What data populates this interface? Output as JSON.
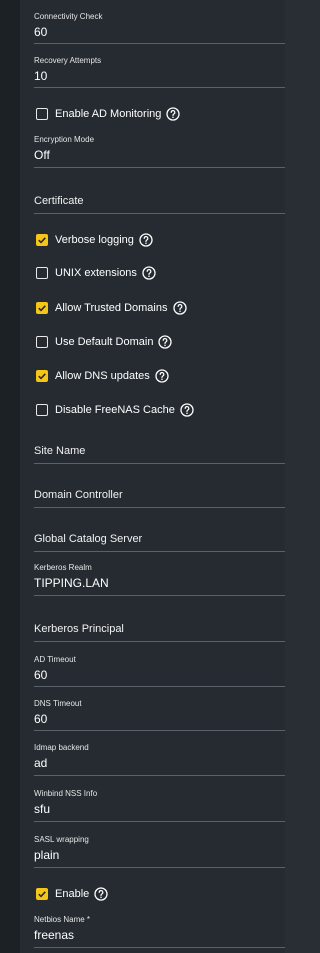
{
  "fields": {
    "connectivity_check": {
      "label": "Connectivity Check",
      "value": "60"
    },
    "recovery_attempts": {
      "label": "Recovery Attempts",
      "value": "10"
    },
    "encryption_mode": {
      "label": "Encryption Mode",
      "value": "Off"
    },
    "certificate": {
      "placeholder": "Certificate"
    },
    "site_name": {
      "placeholder": "Site Name"
    },
    "domain_controller": {
      "placeholder": "Domain Controller"
    },
    "global_catalog_server": {
      "placeholder": "Global Catalog Server"
    },
    "kerberos_realm": {
      "label": "Kerberos Realm",
      "value": "TIPPING.LAN"
    },
    "kerberos_principal": {
      "placeholder": "Kerberos Principal"
    },
    "ad_timeout": {
      "label": "AD Timeout",
      "value": "60"
    },
    "dns_timeout": {
      "label": "DNS Timeout",
      "value": "60"
    },
    "idmap_backend": {
      "label": "Idmap backend",
      "value": "ad"
    },
    "winbind_nss_info": {
      "label": "Winbind NSS Info",
      "value": "sfu"
    },
    "sasl_wrapping": {
      "label": "SASL wrapping",
      "value": "plain"
    },
    "netbios_name": {
      "label": "Netbios Name *",
      "value": "freenas"
    }
  },
  "checkboxes": {
    "enable_ad_monitoring": {
      "label": "Enable AD Monitoring",
      "checked": false
    },
    "verbose_logging": {
      "label": "Verbose logging",
      "checked": true
    },
    "unix_extensions": {
      "label": "UNIX extensions",
      "checked": false
    },
    "allow_trusted_domains": {
      "label": "Allow Trusted Domains",
      "checked": true
    },
    "use_default_domain": {
      "label": "Use Default Domain",
      "checked": false
    },
    "allow_dns_updates": {
      "label": "Allow DNS updates",
      "checked": true
    },
    "disable_freenas_cache": {
      "label": "Disable FreeNAS Cache",
      "checked": false
    },
    "enable": {
      "label": "Enable",
      "checked": true
    }
  },
  "colors": {
    "background": "#252b31",
    "checkbox_checked": "#f5c518",
    "underline": "#5a6168"
  },
  "icons": {
    "help": "help-circle-icon",
    "check": "check-icon"
  }
}
